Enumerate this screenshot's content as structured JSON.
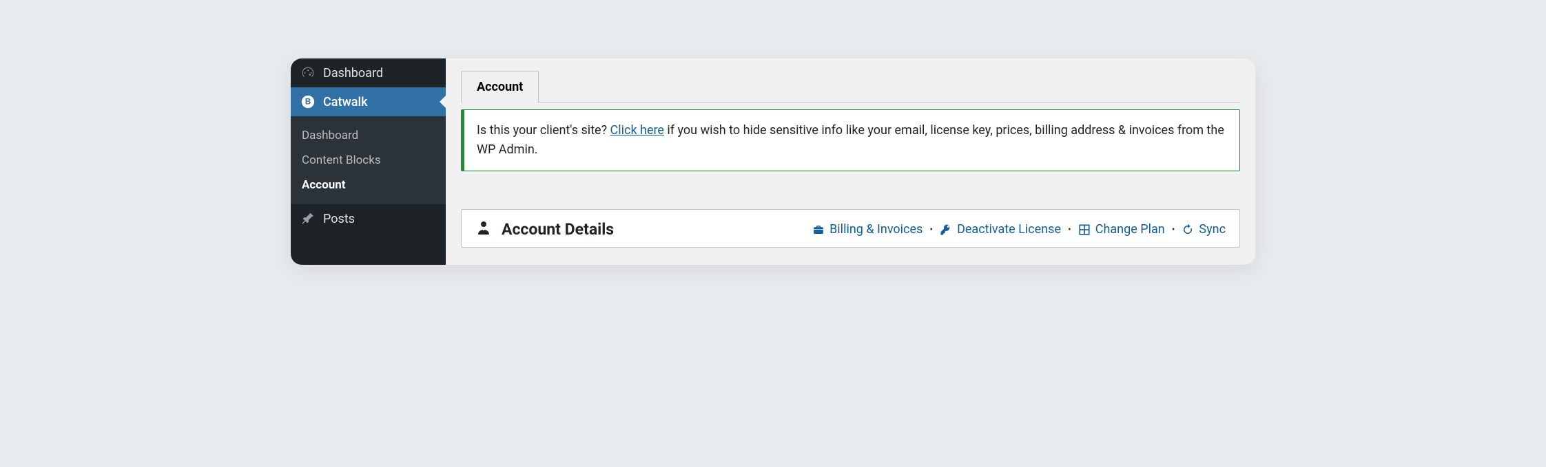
{
  "sidebar": {
    "dashboard_label": "Dashboard",
    "plugin_label": "Catwalk",
    "submenu": {
      "dashboard": "Dashboard",
      "content_blocks": "Content Blocks",
      "account": "Account"
    },
    "posts_label": "Posts"
  },
  "tabs": {
    "account": "Account"
  },
  "notice": {
    "pre": "Is this your client's site? ",
    "link": "Click here",
    "post": " if you wish to hide sensitive info like your email, license key, prices, billing address & invoices from the WP Admin."
  },
  "panel": {
    "title": "Account Details",
    "actions": {
      "billing": "Billing & Invoices",
      "deactivate": "Deactivate License",
      "change_plan": "Change Plan",
      "sync": "Sync"
    }
  }
}
